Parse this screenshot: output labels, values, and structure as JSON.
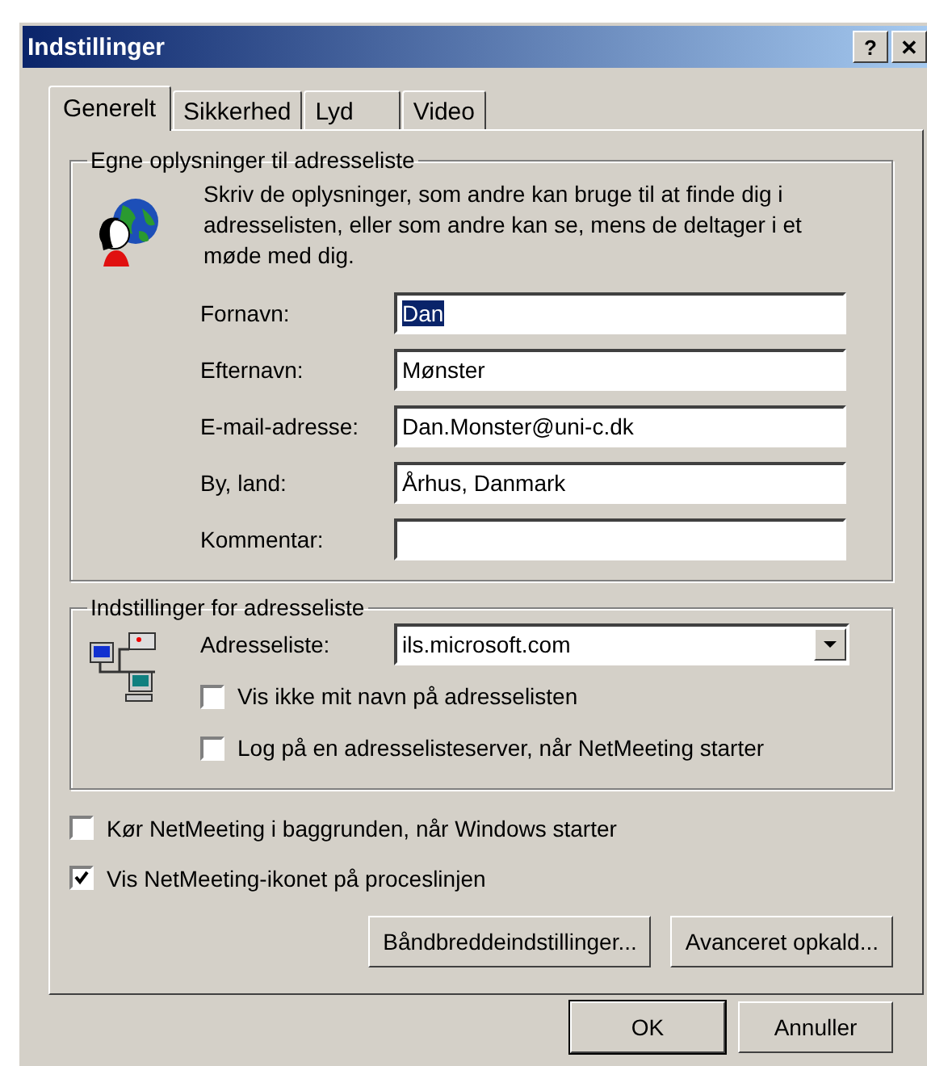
{
  "window": {
    "title": "Indstillinger",
    "title_buttons": [
      "?",
      "✕"
    ]
  },
  "tabs": [
    {
      "label": "Generelt",
      "selected": true
    },
    {
      "label": "Sikkerhed",
      "selected": false
    },
    {
      "label": "Lyd",
      "selected": false
    },
    {
      "label": "Video",
      "selected": false
    }
  ],
  "personal_group": {
    "title": "Egne oplysninger til adresseliste",
    "description": "Skriv de oplysninger, som andre kan bruge til at finde dig i adresselisten, eller som andre kan se, mens de deltager i et møde med dig.",
    "fields": [
      {
        "label": "Fornavn:",
        "value": "Dan",
        "selected": true
      },
      {
        "label": "Efternavn:",
        "value": "Mønster",
        "selected": false
      },
      {
        "label": "E-mail-adresse:",
        "value": "Dan.Monster@uni-c.dk",
        "selected": false
      },
      {
        "label": "By, land:",
        "value": "Århus, Danmark",
        "selected": false
      },
      {
        "label": "Kommentar:"
      }
    ]
  },
  "directory_group": {
    "title": "Indstillinger for adresseliste",
    "directory_label": "Adresseliste:",
    "directory_value": "ils.microsoft.com",
    "options": [
      {
        "label": "Vis ikke mit navn på adresselisten",
        "checked": false
      },
      {
        "label": "Log på en adresselisteserver, når NetMeeting starter",
        "checked": false
      }
    ]
  },
  "options": [
    {
      "label": "Kør NetMeeting i baggrunden, når Windows starter",
      "checked": false
    },
    {
      "label": "Vis NetMeeting-ikonet på proceslinjen",
      "checked": true
    }
  ],
  "panel_buttons": [
    "Båndbreddeindstillinger...",
    "Avanceret opkald..."
  ],
  "dialog_buttons": [
    {
      "label": "OK",
      "default": true
    },
    {
      "label": "Annuller",
      "default": false
    }
  ]
}
